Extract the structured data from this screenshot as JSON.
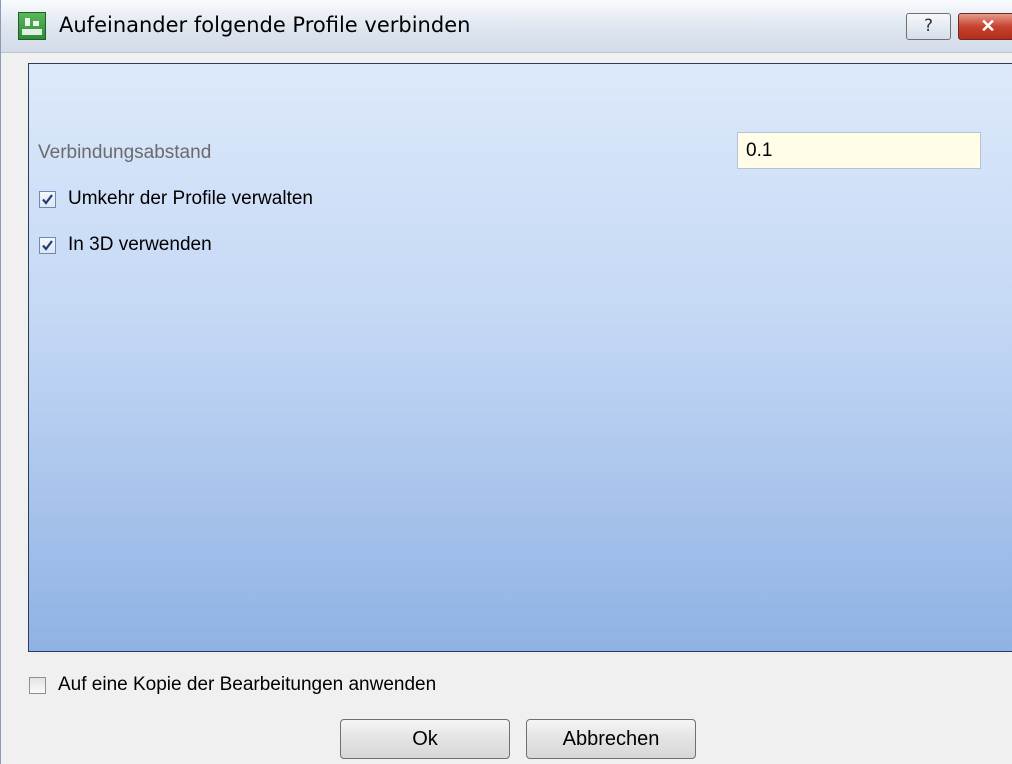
{
  "window": {
    "title": "Aufeinander folgende Profile verbinden",
    "help_label": "?",
    "close_label": "✕"
  },
  "form": {
    "distance_label": "Verbindungsabstand",
    "distance_value": "0.1",
    "reverse_label": "Umkehr der Profile verwalten",
    "reverse_checked": true,
    "use3d_label": "In 3D verwenden",
    "use3d_checked": true
  },
  "footer": {
    "copy_label": "Auf eine Kopie der Bearbeitungen anwenden",
    "copy_checked": false,
    "ok_label": "Ok",
    "cancel_label": "Abbrechen"
  }
}
